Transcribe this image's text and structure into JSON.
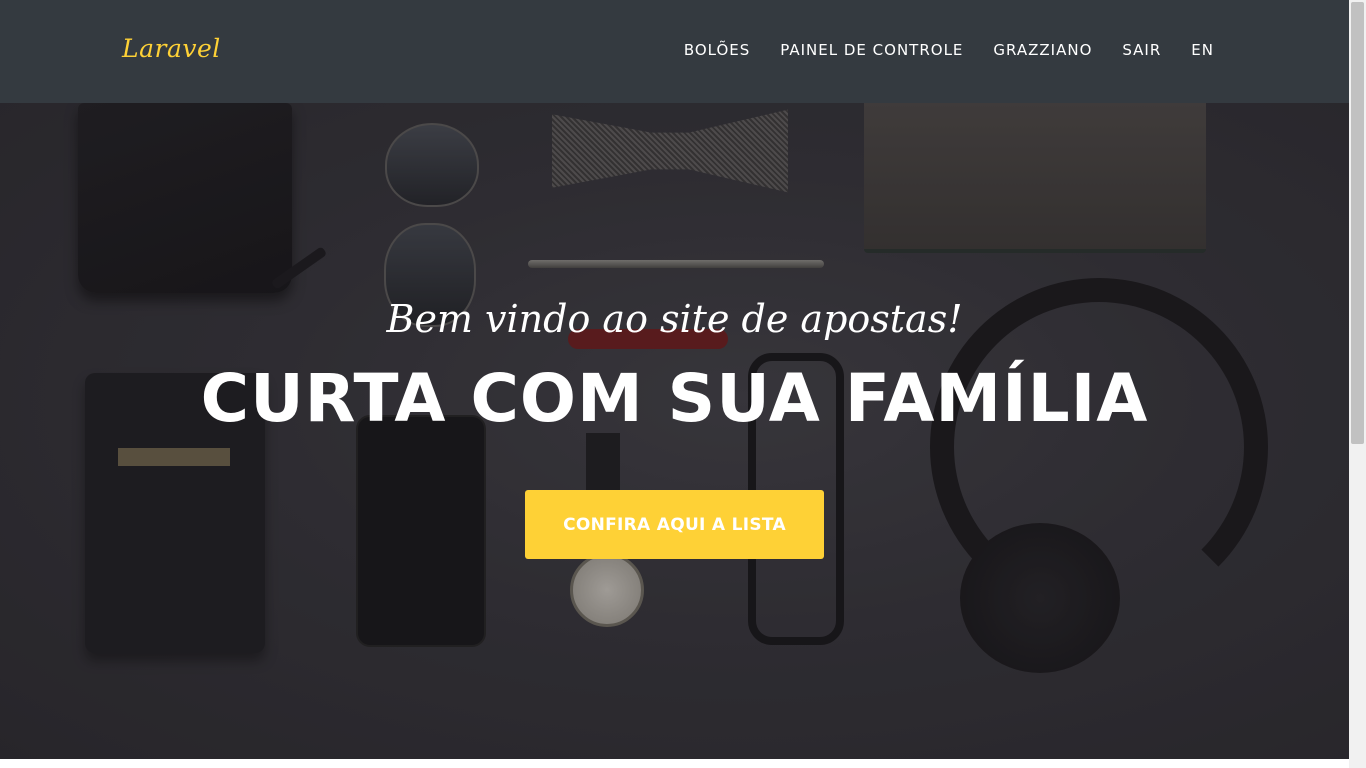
{
  "navbar": {
    "brand": "Laravel",
    "items": [
      {
        "label": "BOLÕES"
      },
      {
        "label": "PAINEL DE CONTROLE"
      },
      {
        "label": "GRAZZIANO"
      },
      {
        "label": "SAIR"
      },
      {
        "label": "EN"
      }
    ]
  },
  "hero": {
    "lead": "Bem vindo ao site de apostas!",
    "heading": "CURTA COM SUA FAMÍLIA",
    "cta_label": "CONFIRA AQUI A LISTA"
  },
  "colors": {
    "accent": "#fed136",
    "navbar_bg": "#343a40"
  }
}
